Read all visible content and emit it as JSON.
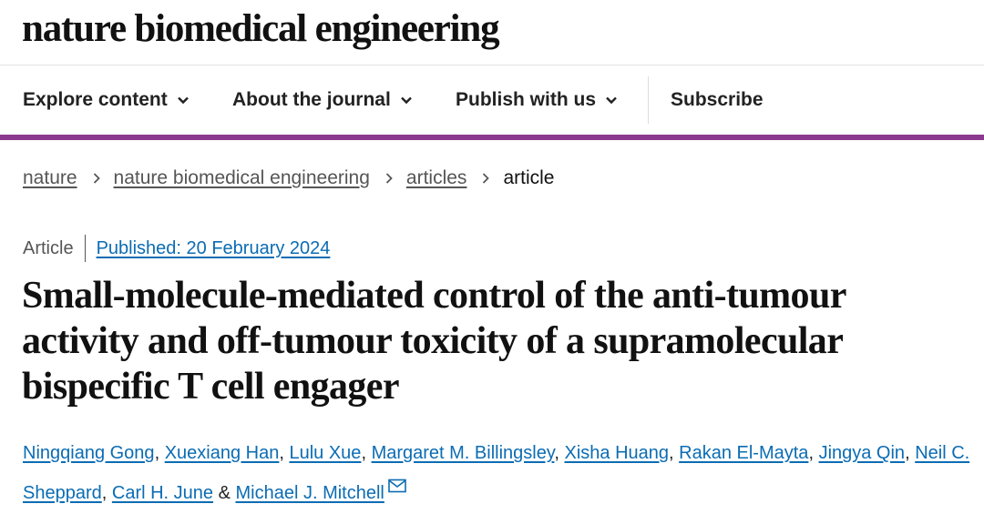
{
  "journal": {
    "name": "nature biomedical engineering"
  },
  "nav": {
    "items": [
      {
        "label": "Explore content",
        "has_dropdown": true,
        "icon": "chevron-down-icon"
      },
      {
        "label": "About the journal",
        "has_dropdown": true,
        "icon": "chevron-down-icon"
      },
      {
        "label": "Publish with us",
        "has_dropdown": true,
        "icon": "chevron-down-icon"
      },
      {
        "label": "Subscribe",
        "has_dropdown": false
      }
    ]
  },
  "breadcrumb": {
    "items": [
      "nature",
      "nature biomedical engineering",
      "articles"
    ],
    "current": "article",
    "separator_icon": "chevron-right-icon"
  },
  "article": {
    "type": "Article",
    "published": "Published: 20 February 2024",
    "title": "Small-molecule-mediated control of the anti-tumour activity and off-tumour toxicity of a supramolecular bispecific T cell engager",
    "authors": [
      "Ningqiang Gong",
      "Xuexiang Han",
      "Lulu Xue",
      "Margaret M. Billingsley",
      "Xisha Huang",
      "Rakan El-Mayta",
      "Jingya Qin",
      "Neil C. Sheppard",
      "Carl H. June",
      "Michael J. Mitchell"
    ],
    "author_separator": ", ",
    "last_author_separator": " & ",
    "corresponding_icon": "mail-icon"
  },
  "colors": {
    "accent_bar": "#8b3a8f",
    "link": "#0b6cb3",
    "text": "#222222",
    "muted": "#555555"
  }
}
